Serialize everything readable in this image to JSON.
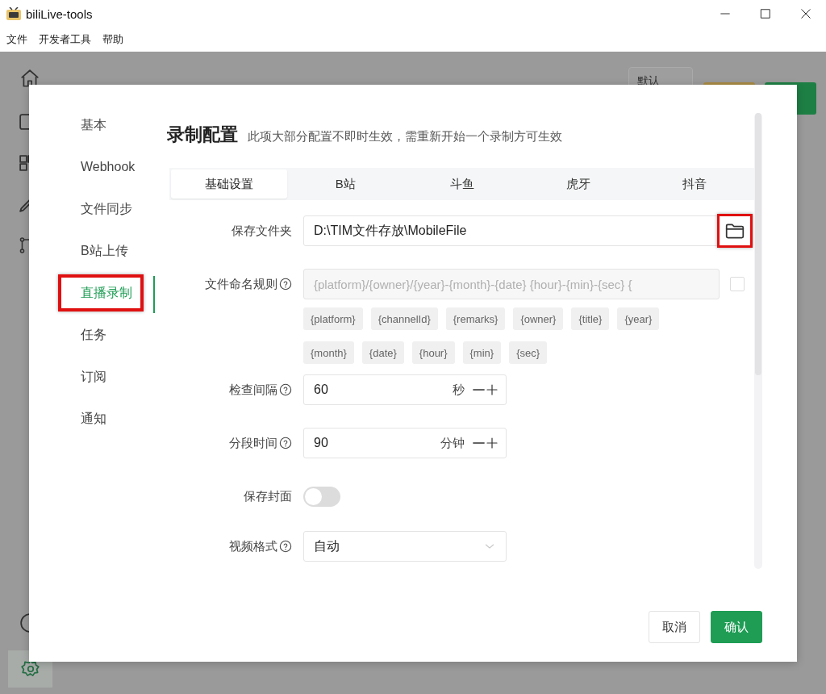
{
  "window": {
    "title": "biliLive-tools"
  },
  "menu": [
    "文件",
    "开发者工具",
    "帮助"
  ],
  "background": {
    "button": "默认"
  },
  "dialog": {
    "nav": [
      {
        "label": "基本",
        "selected": false,
        "highlighted": false
      },
      {
        "label": "Webhook",
        "selected": false,
        "highlighted": false
      },
      {
        "label": "文件同步",
        "selected": false,
        "highlighted": false
      },
      {
        "label": "B站上传",
        "selected": false,
        "highlighted": false
      },
      {
        "label": "直播录制",
        "selected": true,
        "highlighted": true
      },
      {
        "label": "任务",
        "selected": false,
        "highlighted": false
      },
      {
        "label": "订阅",
        "selected": false,
        "highlighted": false
      },
      {
        "label": "通知",
        "selected": false,
        "highlighted": false
      }
    ],
    "title": "录制配置",
    "subtitle": "此项大部分配置不即时生效，需重新开始一个录制方可生效",
    "tabs": [
      {
        "label": "基础设置",
        "selected": true
      },
      {
        "label": "B站",
        "selected": false
      },
      {
        "label": "斗鱼",
        "selected": false
      },
      {
        "label": "虎牙",
        "selected": false
      },
      {
        "label": "抖音",
        "selected": false
      }
    ],
    "fields": [
      {
        "kind": "folder",
        "label": "保存文件夹",
        "help": false,
        "value": "D:\\TIM文件存放\\MobileFile",
        "highlighted": true
      },
      {
        "kind": "template",
        "label": "文件命名规则",
        "help": true,
        "value": "{platform}/{owner}/{year}-{month}-{date} {hour}-{min}-{sec} {",
        "disabled": true,
        "checked": false,
        "chips": [
          "{platform}",
          "{channelId}",
          "{remarks}",
          "{owner}",
          "{title}",
          "{year}",
          "{month}",
          "{date}",
          "{hour}",
          "{min}",
          "{sec}"
        ]
      },
      {
        "kind": "number",
        "label": "检查间隔",
        "help": true,
        "value": "60",
        "unit": "秒"
      },
      {
        "kind": "number",
        "label": "分段时间",
        "help": true,
        "value": "90",
        "unit": "分钟"
      },
      {
        "kind": "switch",
        "label": "保存封面",
        "help": false,
        "on": false
      },
      {
        "kind": "select",
        "label": "视频格式",
        "help": true,
        "value": "自动"
      }
    ],
    "buttons": [
      {
        "label": "取消",
        "kind": "default"
      },
      {
        "label": "确认",
        "kind": "primary"
      }
    ]
  }
}
